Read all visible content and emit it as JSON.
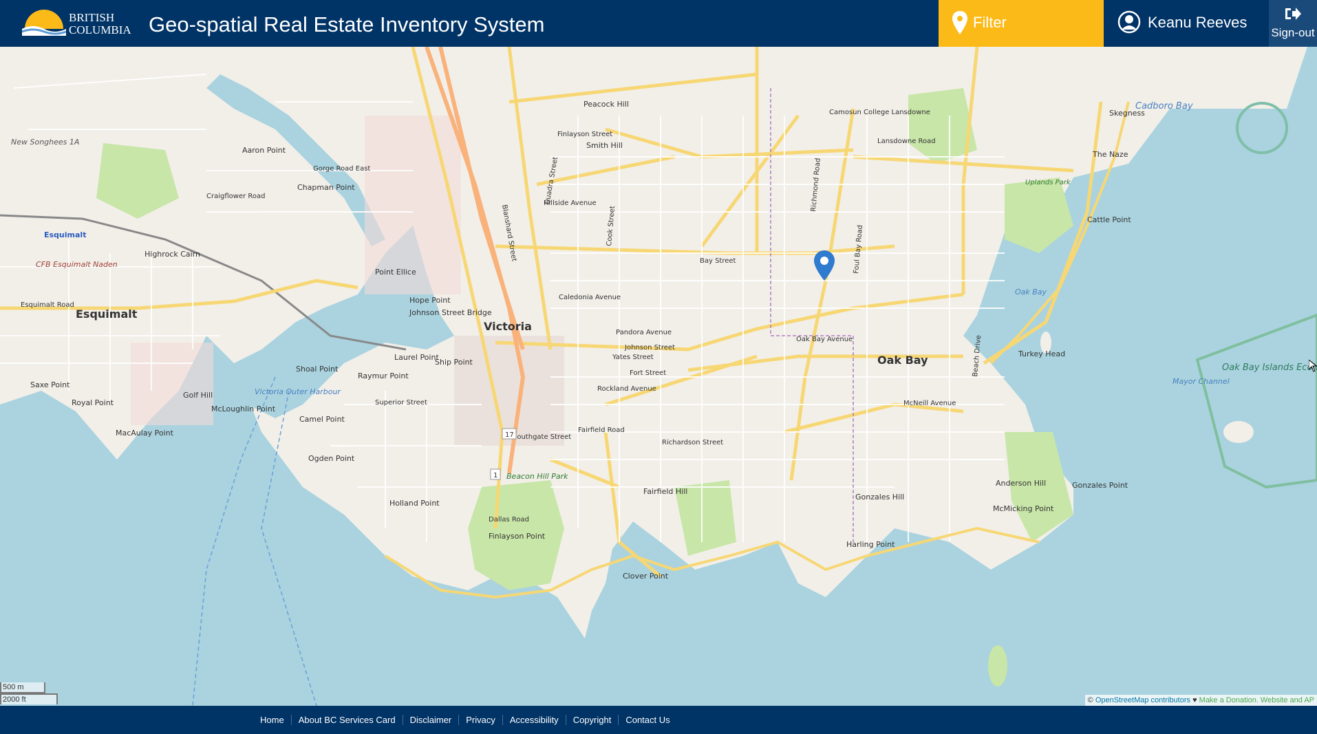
{
  "header": {
    "org_name_line1": "British",
    "org_name_line2": "Columbia",
    "title": "Geo-spatial Real Estate Inventory System",
    "filter_label": "Filter",
    "user_name": "Keanu Reeves",
    "signout_label": "Sign-out",
    "brand_color": "#003366",
    "accent_color": "#fcba19"
  },
  "map": {
    "places": {
      "victoria": "Victoria",
      "esquimalt": "Esquimalt",
      "oak_bay": "Oak Bay",
      "esquimalt_station": "Esquimalt",
      "cadboro_bay": "Cadboro Bay",
      "oak_bay_water": "Oak Bay",
      "skegness": "Skegness",
      "the_naze": "The Naze",
      "cattle_point": "Cattle Point",
      "turkey_head": "Turkey Head",
      "gonzales_point": "Gonzales Point",
      "mcmicking_point": "McMicking Point",
      "clover_point": "Clover Point",
      "finlayson_point": "Finlayson Point",
      "holland_point": "Holland Point",
      "ogden_point": "Ogden Point",
      "camel_point": "Camel Point",
      "macaulay_point": "MacAulay Point",
      "mcloughlin_point": "McLoughlin Point",
      "royal_point": "Royal Point",
      "saxe_point": "Saxe Point",
      "shoal_point": "Shoal Point",
      "laurel_point": "Laurel Point",
      "ship_point": "Ship Point",
      "raymur_point": "Raymur Point",
      "harling_point": "Harling Point",
      "anderson_hill": "Anderson Hill",
      "beacon_hill_park": "Beacon Hill Park",
      "fairfield_hill": "Fairfield Hill",
      "gonzales_hill": "Gonzales Hill",
      "ecological_reserve": "Oak Bay Islands Ecological Reserve",
      "victoria_outer_harbour": "Victoria Outer Harbour",
      "new_songhees": "New Songhees 1A",
      "aaron_point": "Aaron Point",
      "chapman_point": "Chapman Point",
      "point_ellice": "Point Ellice",
      "hope_point": "Hope Point",
      "johnson_street_bridge": "Johnson Street Bridge",
      "highrock_cairn": "Highrock Cairn",
      "cfb_esquimalt": "CFB Esquimalt Naden",
      "golf_hill": "Golf Hill",
      "peacock_hill": "Peacock Hill",
      "smith_hill": "Smith Hill",
      "camosun_college": "Camosun College Lansdowne",
      "uplands_park": "Uplands Park",
      "mayor_channel": "Mayor Channel"
    },
    "streets": {
      "bay_street": "Bay Street",
      "pandora": "Pandora Avenue",
      "johnson": "Johnson Street",
      "fort": "Fort Street",
      "yates": "Yates Street",
      "oak_bay_ave": "Oak Bay Avenue",
      "mcneill": "McNeill Avenue",
      "rockland": "Rockland Avenue",
      "fairfield": "Fairfield Road",
      "dallas": "Dallas Road",
      "hillside": "Hillside Avenue",
      "finlayson": "Finlayson Street",
      "lansdowne": "Lansdowne Road",
      "richmond": "Richmond Road",
      "foul_bay": "Foul Bay Road",
      "cook": "Cook Street",
      "quadra": "Quadra Street",
      "blanshard": "Blanshard Street",
      "esquimalt_road": "Esquimalt Road",
      "craigflower": "Craigflower Road",
      "gorge_road_east": "Gorge Road East",
      "beach_drive": "Beach Drive",
      "caledonia": "Caledonia Avenue",
      "richardson": "Richardson Street",
      "southgate": "Southgate Street",
      "belleville": "Superior Street"
    },
    "route_17": "17",
    "route_1": "1",
    "scale_m": "500 m",
    "scale_ft": "2000 ft",
    "attribution_prefix": "©",
    "attribution_osm": "OpenStreetMap contributors",
    "attribution_heart": "♥",
    "attribution_donate": "Make a Donation. Website and AP",
    "marker_icon": "map-marker-icon"
  },
  "footer": {
    "links": [
      "Home",
      "About BC Services Card",
      "Disclaimer",
      "Privacy",
      "Accessibility",
      "Copyright",
      "Contact Us"
    ]
  }
}
